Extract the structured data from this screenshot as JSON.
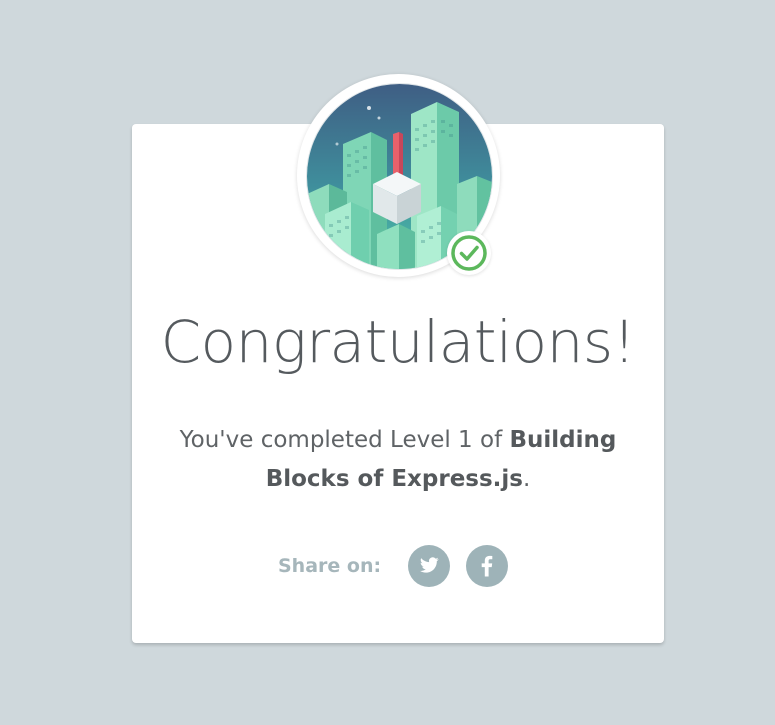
{
  "badge": {
    "icon": "city-skyline-badge",
    "status_icon": "check-circle-icon",
    "colors": {
      "sky_top": "#3f5e84",
      "sky_bottom": "#4fc3a8",
      "building": "#9ee6c6",
      "accent_red": "#e8616b",
      "check": "#5cb85c"
    }
  },
  "congrats": {
    "title": "Congratulations!",
    "message_prefix": "You've completed Level 1 of ",
    "course_name": "Building Blocks of Express.js",
    "message_suffix": "."
  },
  "share": {
    "label": "Share on:",
    "networks": [
      {
        "name": "twitter",
        "icon": "twitter-icon"
      },
      {
        "name": "facebook",
        "icon": "facebook-icon"
      }
    ],
    "icon_bg": "#9eb3b8"
  }
}
